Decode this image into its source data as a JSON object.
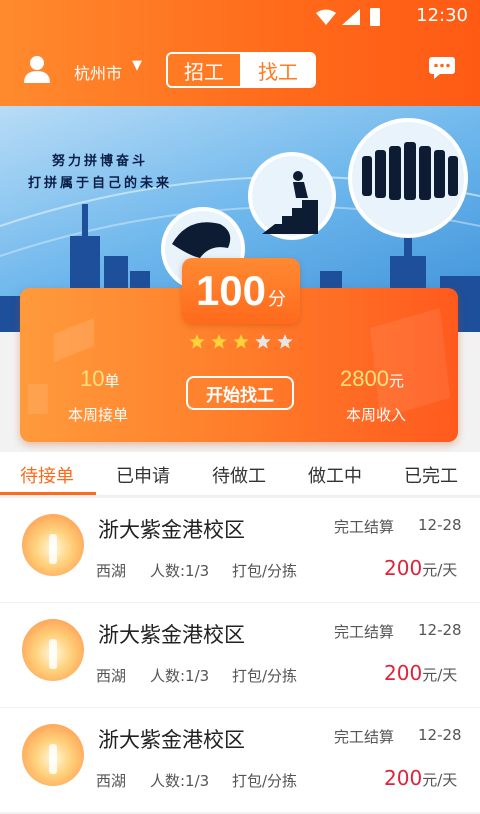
{
  "status": {
    "time": "12:30"
  },
  "header": {
    "city": "杭州市",
    "segments": [
      "招工",
      "找工"
    ],
    "active_segment": 1
  },
  "banner": {
    "slogan_line1": "努力拼博奋斗",
    "slogan_line2": "打拼属于自己的未来"
  },
  "score_card": {
    "score": "100",
    "score_unit": "分",
    "stars_filled": 3,
    "stars_total": 5,
    "weekly_orders_value": "10",
    "weekly_orders_unit": "单",
    "weekly_orders_label": "本周接单",
    "start_button": "开始找工",
    "weekly_income_value": "2800",
    "weekly_income_unit": "元",
    "weekly_income_label": "本周收入"
  },
  "tabs": [
    "待接单",
    "已申请",
    "待做工",
    "做工中",
    "已完工"
  ],
  "active_tab": 0,
  "jobs": [
    {
      "title": "浙大紫金港校区",
      "settle": "完工结算",
      "date": "12-28",
      "area": "西湖",
      "count": "人数:1/3",
      "type": "打包/分拣",
      "price": "200",
      "price_unit": "元/天"
    },
    {
      "title": "浙大紫金港校区",
      "settle": "完工结算",
      "date": "12-28",
      "area": "西湖",
      "count": "人数:1/3",
      "type": "打包/分拣",
      "price": "200",
      "price_unit": "元/天"
    },
    {
      "title": "浙大紫金港校区",
      "settle": "完工结算",
      "date": "12-28",
      "area": "西湖",
      "count": "人数:1/3",
      "type": "打包/分拣",
      "price": "200",
      "price_unit": "元/天"
    }
  ],
  "colors": {
    "accent": "#ff6a1a",
    "price": "#e0233a",
    "star_filled": "#ffd23a",
    "star_empty": "#e6e6e6"
  },
  "icons": [
    "user-icon",
    "caret-down-icon",
    "message-icon",
    "star-icon"
  ]
}
